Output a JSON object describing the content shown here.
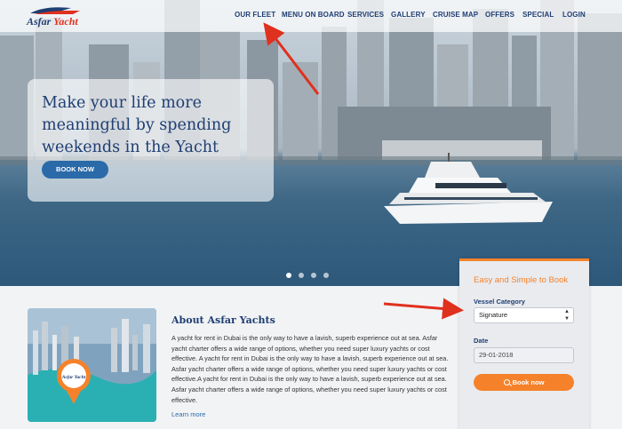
{
  "logo": {
    "text_a": "Asfar",
    "text_b": "Yacht"
  },
  "nav": {
    "items": [
      "OUR FLEET",
      "MENU ON BOARD",
      "SERVICES",
      "GALLERY",
      "CRUISE MAP",
      "OFFERS",
      "SPECIAL",
      "LOGIN"
    ]
  },
  "hero": {
    "headline": "Make your life more meaningful by spending weekends in the Yacht",
    "cta": "BOOK NOW",
    "slides": 4,
    "active_slide": 1
  },
  "about": {
    "title": "About Asfar Yachts",
    "body": "A yacht for rent in Dubai is the only way to have a lavish, superb experience out at sea. Asfar yacht charter offers a wide range of options, whether you need super luxury yachts or cost effective. A yacht for rent in Dubai is the only way to have a lavish, superb experience out at sea. Asfar yacht charter offers a wide range of options, whether you need super luxury yachts or cost effective.A yacht for rent in Dubai is the only way to have a lavish, superb experience out at sea. Asfar yacht charter offers a wide range of options, whether you need super luxury yachts or cost effective.",
    "link": "Learn more",
    "image_label": "Asfar Yacht"
  },
  "booking": {
    "title": "Easy and Simple to Book",
    "vessel_label": "Vessel Category",
    "vessel_value": "Signature",
    "date_label": "Date",
    "date_value": "29-01-2018",
    "button": "Book now"
  },
  "colors": {
    "brand": "#1f3e73",
    "accent": "#f5822a",
    "link": "#2a6aa8",
    "arrow": "#e0301e"
  }
}
